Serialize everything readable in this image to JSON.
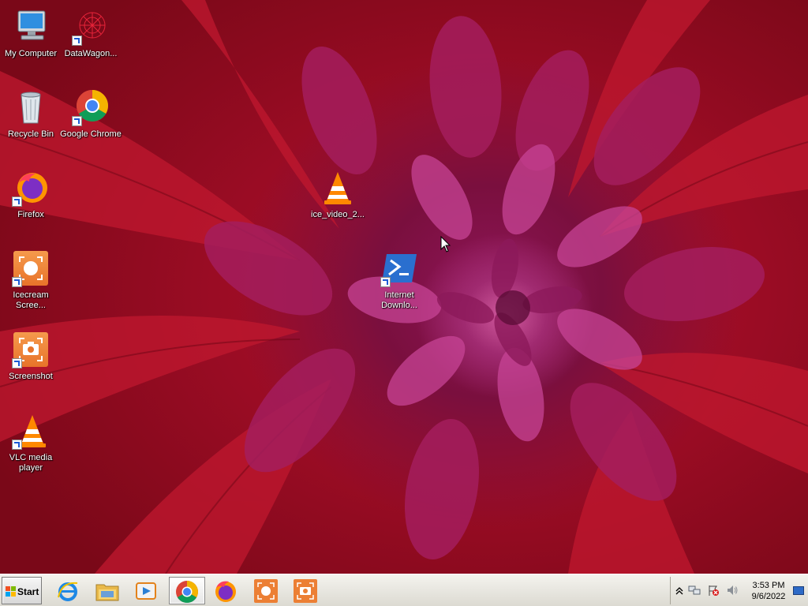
{
  "desktop": {
    "icons": {
      "my_computer": "My Computer",
      "datawagon": "DataWagon...",
      "recycle_bin": "Recycle Bin",
      "google_chrome": "Google Chrome",
      "firefox": "Firefox",
      "ice_video": "ice_video_2...",
      "icecream_line1": "Icecream",
      "icecream_line2": "Scree...",
      "internet_line1": "Internet",
      "internet_line2": "Downlo...",
      "screenshot": "Screenshot",
      "vlc_line1": "VLC media",
      "vlc_line2": "player"
    }
  },
  "taskbar": {
    "start_label": "Start",
    "pinned": [
      "internet-explorer-icon",
      "file-explorer-icon",
      "windows-media-player-icon",
      "chrome-icon",
      "firefox-icon",
      "icecream-recorder-icon",
      "screenshot-tool-icon"
    ],
    "active_app": "chrome-icon"
  },
  "tray": {
    "time": "3:53 PM",
    "date": "9/6/2022",
    "icons": [
      "show-hidden-icons-chevron",
      "network-icon",
      "action-center-flag-icon",
      "volume-icon"
    ]
  },
  "colors": {
    "wallpaper_red": "#a20f28",
    "wallpaper_magenta": "#a02a70",
    "taskbar_bg": "#e8e6df",
    "icon_orange": "#e8732a"
  }
}
